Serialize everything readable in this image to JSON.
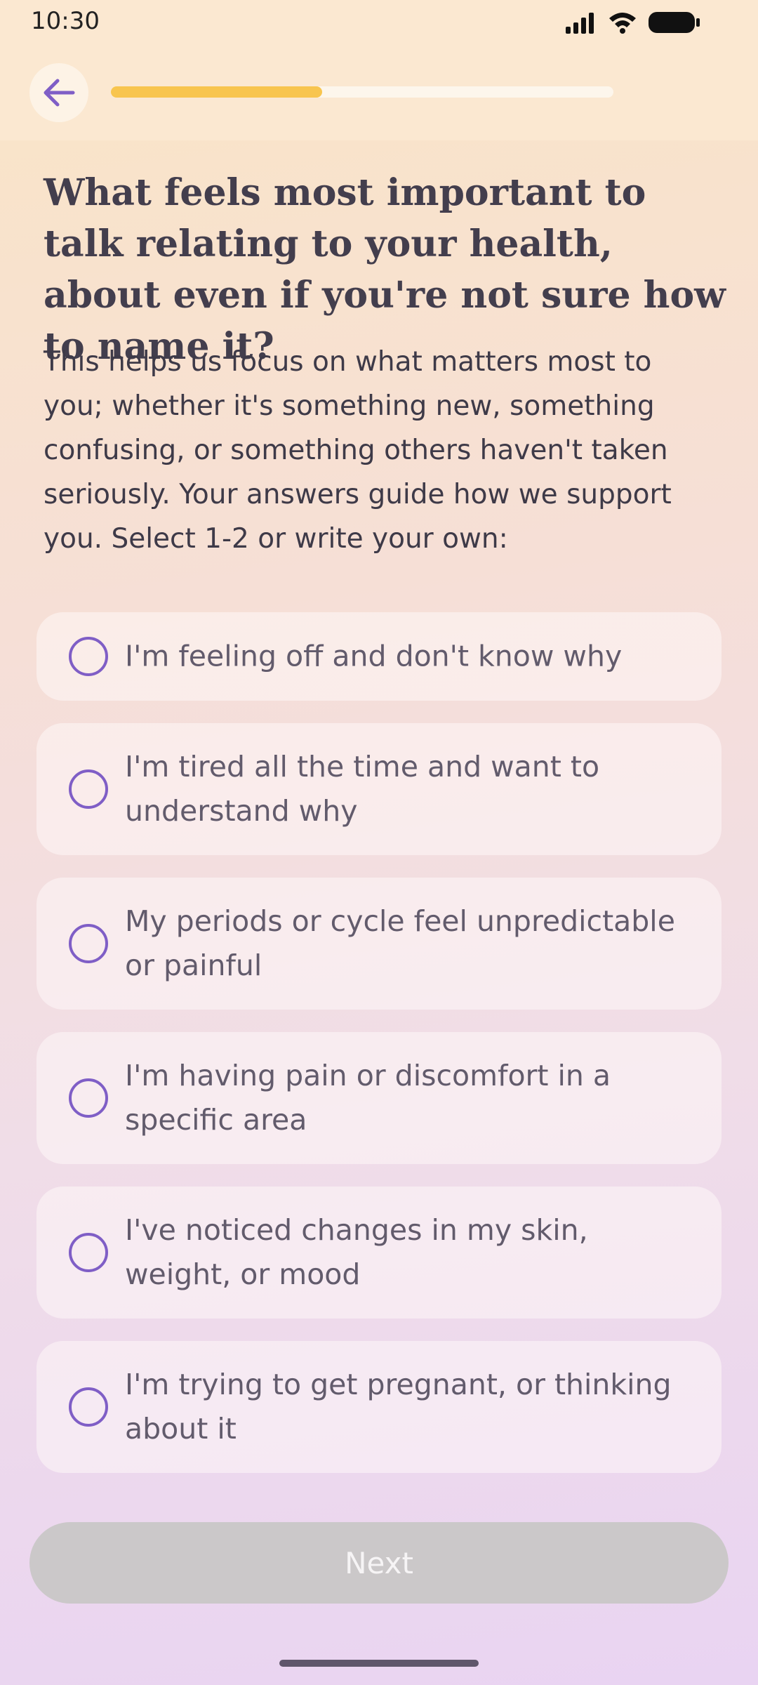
{
  "status_bar": {
    "time": "10:30",
    "icons": [
      "signal-icon",
      "wifi-icon",
      "battery-icon"
    ]
  },
  "header": {
    "back_icon": "arrow-left-icon",
    "progress_fraction": 0.42,
    "progress_color": "#f8c54e",
    "accent_color": "#7f5ec6"
  },
  "question": {
    "title": "What feels most important to talk relating to your health, about even if you're not sure how to name it?",
    "description": "This helps us focus on what matters most to you; whether it's something new, something confusing, or something others haven't taken seriously. Your answers guide how we support you. Select 1-2 or write your own:"
  },
  "options": [
    {
      "label": "I'm feeling off and don't know why",
      "selected": false
    },
    {
      "label": "I'm tired all the time and want to understand why",
      "selected": false
    },
    {
      "label": "My periods or cycle feel unpredictable or painful",
      "selected": false
    },
    {
      "label": "I'm having pain or discomfort in a specific area",
      "selected": false
    },
    {
      "label": "I've noticed changes in my skin, weight, or mood",
      "selected": false
    },
    {
      "label": "I'm trying to get pregnant, or thinking about it",
      "selected": false
    }
  ],
  "footer": {
    "next_label": "Next",
    "next_disabled": true
  }
}
